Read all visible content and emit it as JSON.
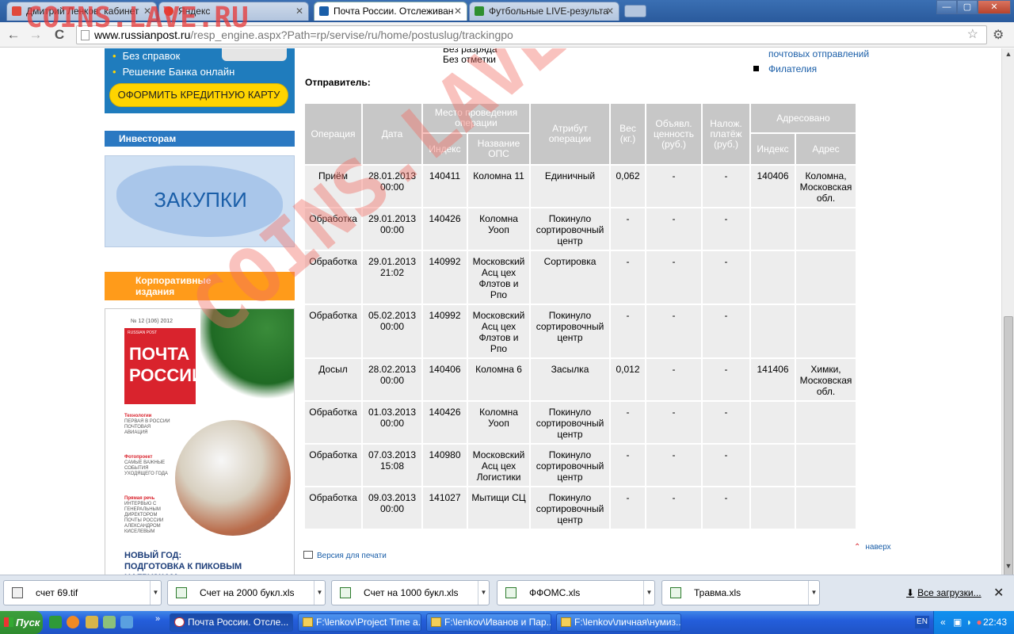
{
  "watermark": "COINS.LAVE.RU",
  "tabs": [
    {
      "title": "Дмитрий Ленков: кабинет",
      "color": "#e0483a"
    },
    {
      "title": "Яндекс",
      "color": "#e53b2c"
    },
    {
      "title": "Почта России. Отслеживан",
      "color": "#1a5ea8"
    },
    {
      "title": "Футбольные LIVE-результа",
      "color": "#2f8f2f"
    }
  ],
  "window_buttons": {
    "min": "—",
    "max": "▢",
    "close": "✕"
  },
  "nav": {
    "back": "←",
    "forward": "→",
    "reload": "C"
  },
  "url": {
    "host": "www.russianpost.ru",
    "path": "/resp_engine.aspx?Path=rp/servise/ru/home/postuslug/trackingpo"
  },
  "sidebar": {
    "promo_items": [
      "Без справок",
      "Решение Банка онлайн"
    ],
    "cta": "ОФОРМИТЬ КРЕДИТНУЮ КАРТУ",
    "investors": "Инвесторам",
    "procurement": "ЗАКУПКИ",
    "corporate": [
      "Корпоративные",
      "издания"
    ],
    "magazine": {
      "issue": "№ 12 (106) 2012",
      "brand": "RUSSIAN POST",
      "title1": "ПОЧТА",
      "title2": "РОССИИ",
      "blurbs": [
        {
          "head": "Технологии",
          "text": "ПЕРВАЯ В РОССИИ ПОЧТОВАЯ АВИАЦИЯ"
        },
        {
          "head": "Фотопроект",
          "text": "САМЫЕ ВАЖНЫЕ СОБЫТИЯ УХОДЯЩЕГО ГОДА"
        },
        {
          "head": "Прямая речь",
          "text": "ИНТЕРВЬЮ С ГЕНЕРАЛЬНЫМ ДИРЕКТОРОМ ПОЧТЫ РОССИИ АЛЕКСАНДРОМ КИСЕЛЕВЫМ"
        }
      ],
      "bottom1": "НОВЫЙ ГОД:",
      "bottom2": "ПОДГОТОВКА К ПИКОВЫМ НАГРУЗКАМ"
    }
  },
  "meta_lines": [
    "Без разряда",
    "Без отметки"
  ],
  "sender_label": "Отправитель:",
  "right_links": {
    "link1": "почтовых отправлений",
    "link2": "Филателия"
  },
  "table": {
    "headers": {
      "operation": "Операция",
      "date": "Дата",
      "place": "Место проведения операции",
      "index": "Индекс",
      "ops_name": "Название ОПС",
      "attribute": "Атрибут операции",
      "weight": "Вес (кг.)",
      "declared": "Объявл. ценность (руб.)",
      "cod": "Налож. платёж (руб.)",
      "addressed": "Адресовано",
      "addr_index": "Индекс",
      "address": "Адрес"
    },
    "rows": [
      {
        "op": "Приём",
        "date": "28.01.2013 00:00",
        "idx": "140411",
        "ops": "Коломна 11",
        "attr": "Единичный",
        "w": "0,062",
        "dv": "-",
        "cod": "-",
        "aidx": "140406",
        "addr": "Коломна, Московская обл."
      },
      {
        "op": "Обработка",
        "date": "29.01.2013 00:00",
        "idx": "140426",
        "ops": "Коломна Уооп",
        "attr": "Покинуло сортировочный центр",
        "w": "-",
        "dv": "-",
        "cod": "-",
        "aidx": "",
        "addr": ""
      },
      {
        "op": "Обработка",
        "date": "29.01.2013 21:02",
        "idx": "140992",
        "ops": "Московский Асц цех Флэтов и Рпо",
        "attr": "Сортировка",
        "w": "-",
        "dv": "-",
        "cod": "-",
        "aidx": "",
        "addr": ""
      },
      {
        "op": "Обработка",
        "date": "05.02.2013 00:00",
        "idx": "140992",
        "ops": "Московский Асц цех Флэтов и Рпо",
        "attr": "Покинуло сортировочный центр",
        "w": "-",
        "dv": "-",
        "cod": "-",
        "aidx": "",
        "addr": ""
      },
      {
        "op": "Досыл",
        "date": "28.02.2013 00:00",
        "idx": "140406",
        "ops": "Коломна 6",
        "attr": "Засылка",
        "w": "0,012",
        "dv": "-",
        "cod": "-",
        "aidx": "141406",
        "addr": "Химки, Московская обл."
      },
      {
        "op": "Обработка",
        "date": "01.03.2013 00:00",
        "idx": "140426",
        "ops": "Коломна Уооп",
        "attr": "Покинуло сортировочный центр",
        "w": "-",
        "dv": "-",
        "cod": "-",
        "aidx": "",
        "addr": ""
      },
      {
        "op": "Обработка",
        "date": "07.03.2013 15:08",
        "idx": "140980",
        "ops": "Московский Асц цех Логистики",
        "attr": "Покинуло сортировочный центр",
        "w": "-",
        "dv": "-",
        "cod": "-",
        "aidx": "",
        "addr": ""
      },
      {
        "op": "Обработка",
        "date": "09.03.2013 00:00",
        "idx": "141027",
        "ops": "Мытищи СЦ",
        "attr": "Покинуло сортировочный центр",
        "w": "-",
        "dv": "-",
        "cod": "-",
        "aidx": "",
        "addr": ""
      }
    ]
  },
  "print_version": "Версия для печати",
  "to_top": "наверх",
  "downloads": {
    "items": [
      "счет 69.tif",
      "Счет на 2000 букл.xls",
      "Счет на 1000 букл.xls",
      "ФФОМС.xls",
      "Травма.xls"
    ],
    "all": "Все загрузки...",
    "close": "✕"
  },
  "taskbar": {
    "start": "Пуск",
    "tasks": [
      "Почта России. Отсле...",
      "F:\\lenkov\\Project Time a...",
      "F:\\lenkov\\Иванов и Пар...",
      "F:\\lenkov\\личная\\нумиз..."
    ],
    "lang": "EN",
    "clock": "22:43"
  }
}
